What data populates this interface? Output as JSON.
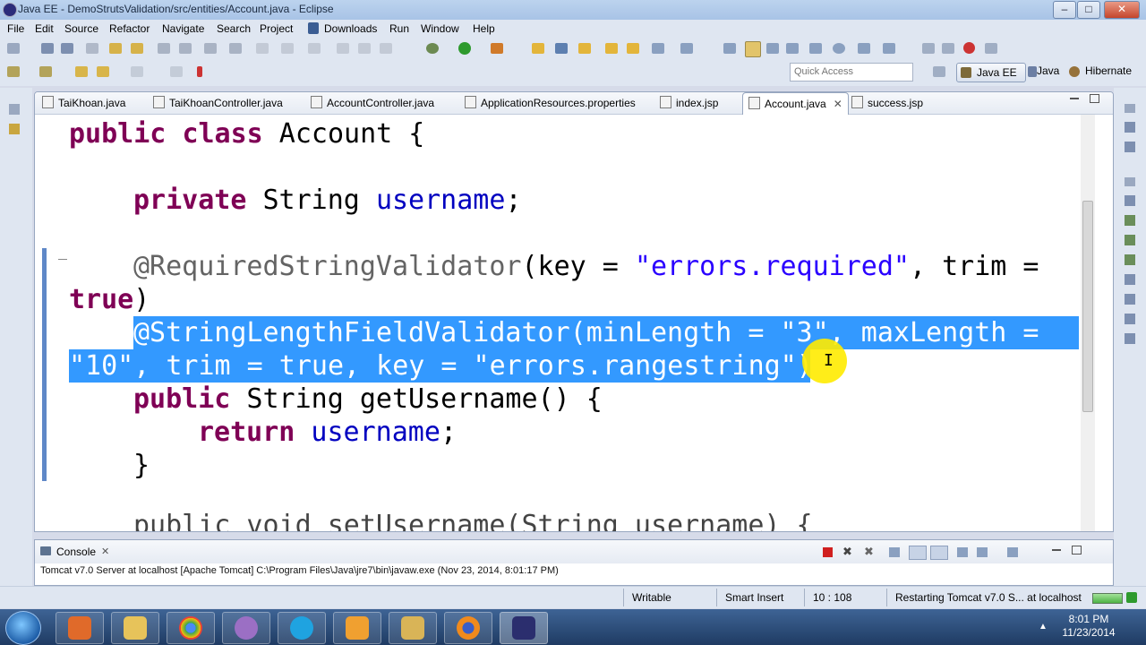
{
  "window": {
    "title": "Java EE - DemoStrutsValidation/src/entities/Account.java - Eclipse",
    "min_label": "–",
    "max_label": "□",
    "close_label": "✕"
  },
  "menu": [
    "File",
    "Edit",
    "Source",
    "Refactor",
    "Navigate",
    "Search",
    "Project",
    "Downloads",
    "Run",
    "Window",
    "Help"
  ],
  "quick_access": {
    "placeholder": "Quick Access"
  },
  "perspectives": [
    "Java EE",
    "Java",
    "Hibernate"
  ],
  "editor": {
    "tabs": [
      {
        "label": "TaiKhoan.java"
      },
      {
        "label": "TaiKhoanController.java"
      },
      {
        "label": "AccountController.java"
      },
      {
        "label": "ApplicationResources.properties"
      },
      {
        "label": "index.jsp"
      },
      {
        "label": "Account.java",
        "active": true
      },
      {
        "label": "success.jsp"
      }
    ],
    "close_glyph": "✕",
    "code": {
      "l1": {
        "kw1": "public",
        "kw2": "class",
        "name": " Account {"
      },
      "l3": {
        "kw": "private",
        "type": " String ",
        "field": "username",
        "end": ";"
      },
      "l5": {
        "ann": "@RequiredStringValidator",
        "p1": "(key = ",
        "s1": "\"errors.required\"",
        "p2": ", trim ="
      },
      "l6": {
        "kw": "true",
        "p": ")"
      },
      "l7": {
        "text": "@StringLengthFieldValidator(minLength = \"3\", maxLength ="
      },
      "l8": {
        "text": "\"10\", trim = true, key = \"errors.rangestring\")"
      },
      "l9": {
        "kw": "public",
        "type": " String getUsername() {"
      },
      "l10": {
        "kw": "return",
        "field": " username",
        "end": ";"
      },
      "l11": {
        "text": "}"
      },
      "l13": {
        "text": "public void setUsername(String username) {"
      }
    }
  },
  "console": {
    "tab_label": "Console",
    "description": "Tomcat v7.0 Server at localhost [Apache Tomcat] C:\\Program Files\\Java\\jre7\\bin\\javaw.exe (Nov 23, 2014, 8:01:17 PM)"
  },
  "status": {
    "writable": "Writable",
    "insert_mode": "Smart Insert",
    "position": "10 : 108",
    "task": "Restarting Tomcat v7.0 S... at localhost"
  },
  "taskbar": {
    "time": "8:01 PM",
    "date": "11/23/2014",
    "apps": [
      "media-player-icon",
      "explorer-folder-icon",
      "chrome-icon",
      "paint-icon",
      "skype-icon",
      "outlook-icon",
      "file-manager-icon",
      "firefox-icon",
      "eclipse-icon"
    ]
  }
}
